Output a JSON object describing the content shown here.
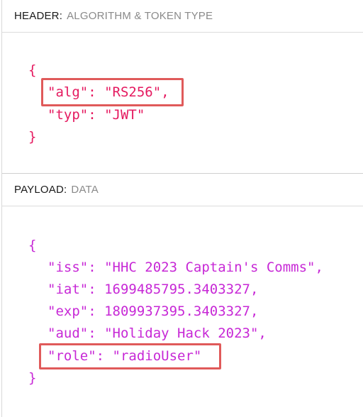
{
  "header_section": {
    "label": "HEADER:",
    "subtitle": "ALGORITHM & TOKEN TYPE",
    "open_brace": "{",
    "close_brace": "}",
    "lines": [
      "\"alg\": \"RS256\",",
      "\"typ\": \"JWT\""
    ]
  },
  "payload_section": {
    "label": "PAYLOAD:",
    "subtitle": "DATA",
    "open_brace": "{",
    "close_brace": "}",
    "lines": [
      "\"iss\": \"HHC 2023 Captain's Comms\",",
      "\"iat\": 1699485795.3403327,",
      "\"exp\": 1809937395.3403327,",
      "\"aud\": \"Holiday Hack 2023\",",
      "\"role\": \"radioUser\""
    ]
  },
  "colors": {
    "header_code": "#e5195f",
    "payload_code": "#c728d6",
    "highlight_box": "#e05a5a"
  }
}
